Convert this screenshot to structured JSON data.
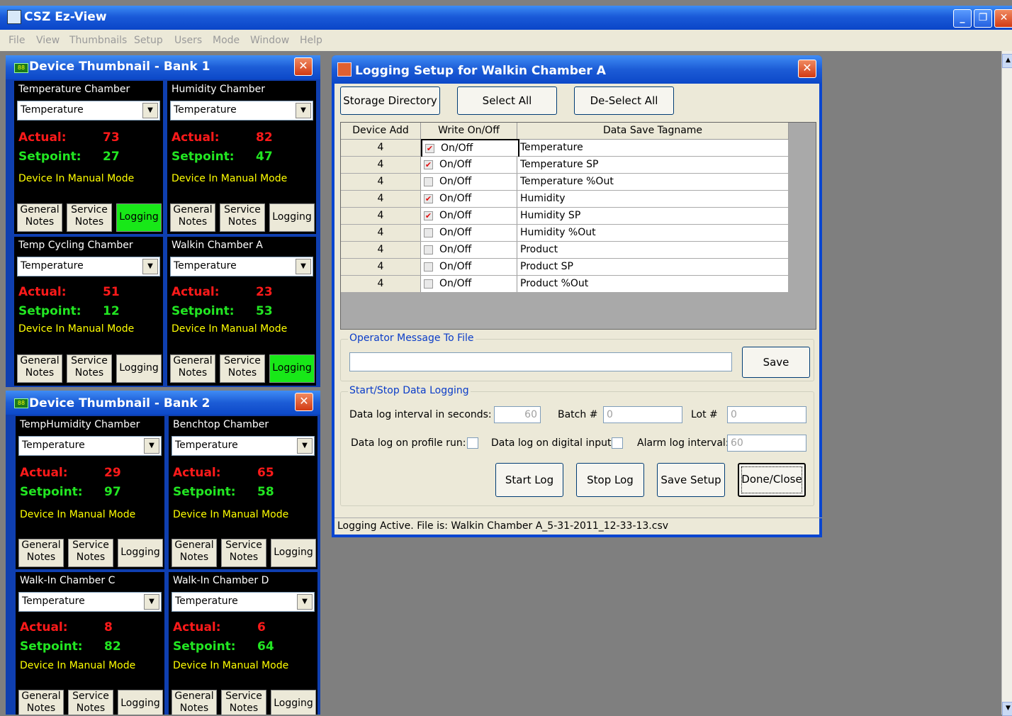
{
  "app": {
    "title": "CSZ Ez-View",
    "menu": [
      "File",
      "View",
      "Thumbnails",
      "Setup",
      "Users",
      "Mode",
      "Window",
      "Help"
    ]
  },
  "banks": [
    {
      "title": "Device Thumbnail - Bank 1",
      "devices": [
        {
          "name": "Temperature Chamber",
          "select": "Temperature",
          "actual_label": "Actual:",
          "actual": "73",
          "setpoint_label": "Setpoint:",
          "setpoint": "27",
          "mode": "Device In Manual Mode",
          "btn_general": [
            "General",
            "Notes"
          ],
          "btn_service": [
            "Service",
            "Notes"
          ],
          "btn_logging": "Logging",
          "logging_active": true
        },
        {
          "name": "Humidity Chamber",
          "select": "Temperature",
          "actual_label": "Actual:",
          "actual": "82",
          "setpoint_label": "Setpoint:",
          "setpoint": "47",
          "mode": "Device In Manual Mode",
          "btn_general": [
            "General",
            "Notes"
          ],
          "btn_service": [
            "Service",
            "Notes"
          ],
          "btn_logging": "Logging",
          "logging_active": false
        },
        {
          "name": "Temp Cycling Chamber",
          "select": "Temperature",
          "actual_label": "Actual:",
          "actual": "51",
          "setpoint_label": "Setpoint:",
          "setpoint": "12",
          "mode": "Device In Manual Mode",
          "btn_general": [
            "General",
            "Notes"
          ],
          "btn_service": [
            "Service",
            "Notes"
          ],
          "btn_logging": "Logging",
          "logging_active": false
        },
        {
          "name": "Walkin Chamber A",
          "select": "Temperature",
          "actual_label": "Actual:",
          "actual": "23",
          "setpoint_label": "Setpoint:",
          "setpoint": "53",
          "mode": "Device In Manual Mode",
          "btn_general": [
            "General",
            "Notes"
          ],
          "btn_service": [
            "Service",
            "Notes"
          ],
          "btn_logging": "Logging",
          "logging_active": true
        }
      ]
    },
    {
      "title": "Device Thumbnail - Bank 2",
      "devices": [
        {
          "name": "TempHumidity Chamber",
          "select": "Temperature",
          "actual_label": "Actual:",
          "actual": "29",
          "setpoint_label": "Setpoint:",
          "setpoint": "97",
          "mode": "Device In Manual Mode",
          "btn_general": [
            "General",
            "Notes"
          ],
          "btn_service": [
            "Service",
            "Notes"
          ],
          "btn_logging": "Logging",
          "logging_active": false
        },
        {
          "name": "Benchtop Chamber",
          "select": "Temperature",
          "actual_label": "Actual:",
          "actual": "65",
          "setpoint_label": "Setpoint:",
          "setpoint": "58",
          "mode": "Device In Manual Mode",
          "btn_general": [
            "General",
            "Notes"
          ],
          "btn_service": [
            "Service",
            "Notes"
          ],
          "btn_logging": "Logging",
          "logging_active": false
        },
        {
          "name": "Walk-In Chamber C",
          "select": "Temperature",
          "actual_label": "Actual:",
          "actual": "8",
          "setpoint_label": "Setpoint:",
          "setpoint": "82",
          "mode": "Device In Manual Mode",
          "btn_general": [
            "General",
            "Notes"
          ],
          "btn_service": [
            "Service",
            "Notes"
          ],
          "btn_logging": "Logging",
          "logging_active": false
        },
        {
          "name": "Walk-In Chamber D",
          "select": "Temperature",
          "actual_label": "Actual:",
          "actual": "6",
          "setpoint_label": "Setpoint:",
          "setpoint": "64",
          "mode": "Device In Manual Mode",
          "btn_general": [
            "General",
            "Notes"
          ],
          "btn_service": [
            "Service",
            "Notes"
          ],
          "btn_logging": "Logging",
          "logging_active": false
        }
      ]
    }
  ],
  "dialog": {
    "title": "Logging Setup for Walkin Chamber A",
    "buttons": {
      "storage": "Storage Directory",
      "select_all": "Select All",
      "deselect_all": "De-Select All"
    },
    "columns": [
      "Device Add",
      "Write On/Off",
      "Data Save Tagname"
    ],
    "rows": [
      {
        "addr": "4",
        "checked": true,
        "write": "On/Off",
        "tag": "Temperature"
      },
      {
        "addr": "4",
        "checked": true,
        "write": "On/Off",
        "tag": "Temperature SP"
      },
      {
        "addr": "4",
        "checked": false,
        "write": "On/Off",
        "tag": "Temperature %Out"
      },
      {
        "addr": "4",
        "checked": true,
        "write": "On/Off",
        "tag": "Humidity"
      },
      {
        "addr": "4",
        "checked": true,
        "write": "On/Off",
        "tag": "Humidity SP"
      },
      {
        "addr": "4",
        "checked": false,
        "write": "On/Off",
        "tag": "Humidity %Out"
      },
      {
        "addr": "4",
        "checked": false,
        "write": "On/Off",
        "tag": "Product"
      },
      {
        "addr": "4",
        "checked": false,
        "write": "On/Off",
        "tag": "Product SP"
      },
      {
        "addr": "4",
        "checked": false,
        "write": "On/Off",
        "tag": "Product %Out"
      }
    ],
    "operator_group": "Operator Message To File",
    "operator_message": "",
    "save": "Save",
    "logging_group": "Start/Stop Data Logging",
    "interval_label": "Data log interval in seconds:",
    "interval_value": "60",
    "batch_label": "Batch #",
    "batch_value": "0",
    "lot_label": "Lot #",
    "lot_value": "0",
    "profile_label": "Data log on profile run:",
    "digital_label": "Data log on digital input:",
    "alarm_label": "Alarm log interval:",
    "alarm_value": "60",
    "start": "Start Log",
    "stop": "Stop Log",
    "save_setup": "Save Setup",
    "done": "Done/Close",
    "status": "Logging Active. File is: Walkin Chamber A_5-31-2011_12-33-13.csv"
  }
}
